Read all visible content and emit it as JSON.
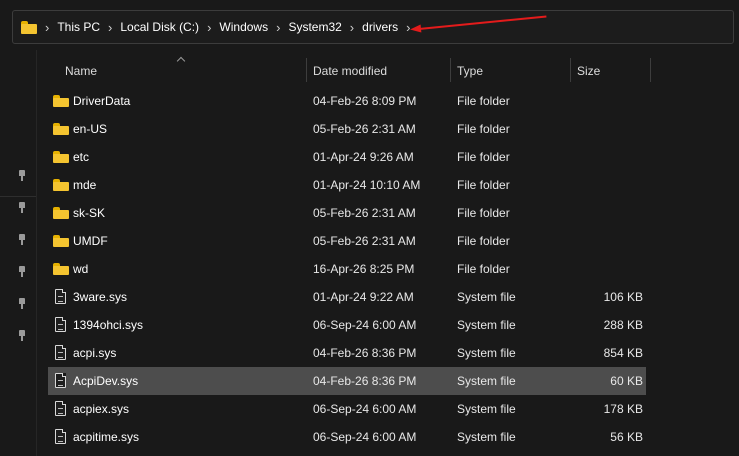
{
  "address": {
    "segments": [
      "This PC",
      "Local Disk (C:)",
      "Windows",
      "System32",
      "drivers"
    ]
  },
  "columns": {
    "name": "Name",
    "date": "Date modified",
    "type": "Type",
    "size": "Size"
  },
  "files": [
    {
      "name": "DriverData",
      "date": "04-Feb-26 8:09 PM",
      "type": "File folder",
      "size": "",
      "kind": "folder"
    },
    {
      "name": "en-US",
      "date": "05-Feb-26 2:31 AM",
      "type": "File folder",
      "size": "",
      "kind": "folder"
    },
    {
      "name": "etc",
      "date": "01-Apr-24 9:26 AM",
      "type": "File folder",
      "size": "",
      "kind": "folder"
    },
    {
      "name": "mde",
      "date": "01-Apr-24 10:10 AM",
      "type": "File folder",
      "size": "",
      "kind": "folder"
    },
    {
      "name": "sk-SK",
      "date": "05-Feb-26 2:31 AM",
      "type": "File folder",
      "size": "",
      "kind": "folder"
    },
    {
      "name": "UMDF",
      "date": "05-Feb-26 2:31 AM",
      "type": "File folder",
      "size": "",
      "kind": "folder"
    },
    {
      "name": "wd",
      "date": "16-Apr-26 8:25 PM",
      "type": "File folder",
      "size": "",
      "kind": "folder"
    },
    {
      "name": "3ware.sys",
      "date": "01-Apr-24 9:22 AM",
      "type": "System file",
      "size": "106 KB",
      "kind": "file"
    },
    {
      "name": "1394ohci.sys",
      "date": "06-Sep-24 6:00 AM",
      "type": "System file",
      "size": "288 KB",
      "kind": "file"
    },
    {
      "name": "acpi.sys",
      "date": "04-Feb-26 8:36 PM",
      "type": "System file",
      "size": "854 KB",
      "kind": "file"
    },
    {
      "name": "AcpiDev.sys",
      "date": "04-Feb-26 8:36 PM",
      "type": "System file",
      "size": "60 KB",
      "kind": "file",
      "selected": true
    },
    {
      "name": "acpiex.sys",
      "date": "06-Sep-24 6:00 AM",
      "type": "System file",
      "size": "178 KB",
      "kind": "file"
    },
    {
      "name": "acpitime.sys",
      "date": "06-Sep-24 6:00 AM",
      "type": "System file",
      "size": "56 KB",
      "kind": "file"
    }
  ],
  "icons": {
    "address": "folder-icon",
    "folder": "folder-icon",
    "file": "system-file-icon",
    "pin": "pin-icon",
    "annotation": "red-arrow-annotation"
  },
  "colors": {
    "background": "#191919",
    "selected_row": "#4d4d4d",
    "folder": "#f4c430",
    "annotation_arrow": "#e41b1b"
  }
}
